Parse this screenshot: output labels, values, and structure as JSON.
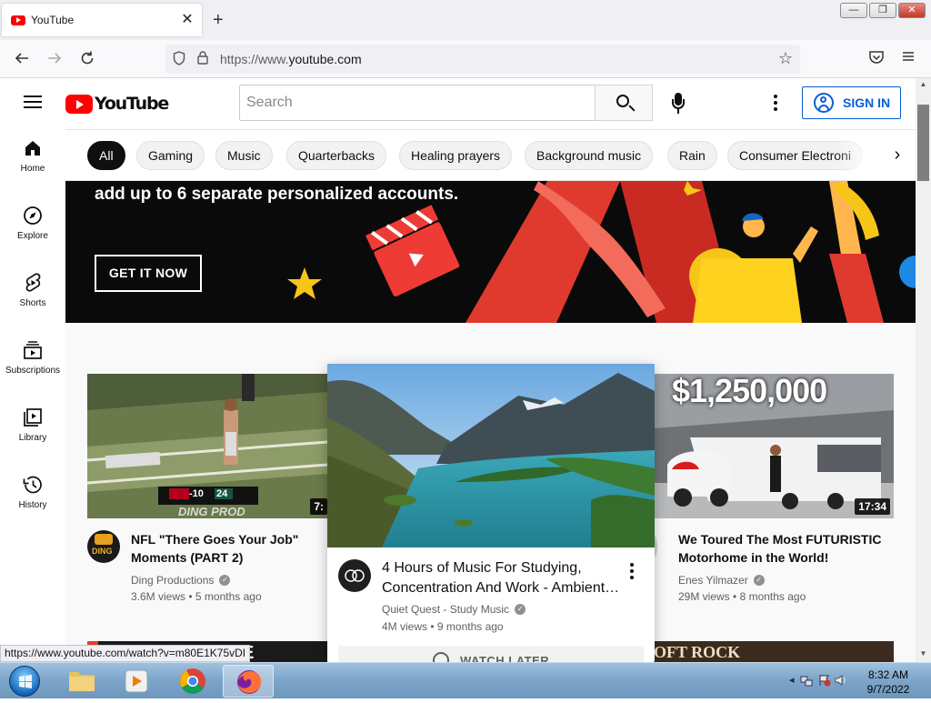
{
  "browser": {
    "tab_title": "YouTube",
    "tab_close": "✕",
    "new_tab": "+",
    "url_prefix": "https://www.",
    "url_domain": "youtube.com",
    "status_link": "https://www.youtube.com/watch?v=m80E1K75vDI",
    "window_buttons": {
      "minimize": "—",
      "restore": "❐",
      "close": "✕"
    }
  },
  "masthead": {
    "logo_text": "YouTube",
    "search_placeholder": "Search",
    "sign_in": "SIGN IN"
  },
  "guide": [
    {
      "label": "Home",
      "icon": "home-icon"
    },
    {
      "label": "Explore",
      "icon": "compass-icon"
    },
    {
      "label": "Shorts",
      "icon": "shorts-icon"
    },
    {
      "label": "Subscriptions",
      "icon": "subscriptions-icon"
    },
    {
      "label": "Library",
      "icon": "library-icon"
    },
    {
      "label": "History",
      "icon": "history-icon"
    }
  ],
  "chips": [
    "All",
    "Gaming",
    "Music",
    "Quarterbacks",
    "Healing prayers",
    "Background music",
    "Rain",
    "Consumer Electroni"
  ],
  "banner": {
    "text": "add up to 6 separate personalized accounts.",
    "button": "GET IT NOW"
  },
  "videos": [
    {
      "title_line1": "NFL \"There Goes Your Job\"",
      "title_line2": "Moments (PART 2)",
      "channel": "Ding Productions",
      "views": "3.6M views",
      "age": "5 months ago",
      "duration": "7:",
      "thumb_overlay": "DING PROD",
      "score_left": "-10",
      "score_right": "24",
      "avatar_text": "DING"
    },
    {
      "title_line1": "4 Hours of Music For Studying,",
      "title_line2": "Concentration And Work - Ambient…",
      "channel": "Quiet Quest - Study Music",
      "views": "4M views",
      "age": "9 months ago",
      "watch_later": "WATCH LATER"
    },
    {
      "title_line1": "We Toured The Most FUTURISTIC",
      "title_line2": "Motorhome in the World!",
      "channel": "Enes Yilmazer",
      "views": "29M views",
      "age": "8 months ago",
      "duration": "17:34",
      "thumb_overlay": "$1,250,000"
    }
  ],
  "next_row": {
    "left_text": "E WORSE",
    "right_text": "OFT ROCK"
  },
  "taskbar": {
    "time": "8:32 AM",
    "date": "9/7/2022"
  },
  "colors": {
    "youtube_red": "#ff0000",
    "link_blue": "#065fd4",
    "text": "#0f0f0f",
    "secondary": "#606060"
  }
}
